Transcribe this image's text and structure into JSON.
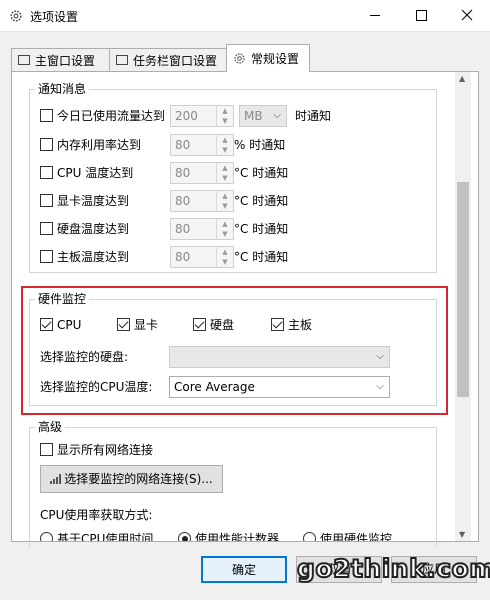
{
  "window": {
    "title": "选项设置"
  },
  "tabs": [
    {
      "label": "主窗口设置"
    },
    {
      "label": "任务栏窗口设置"
    },
    {
      "label": "常规设置"
    }
  ],
  "notify": {
    "title": "通知消息",
    "rows": [
      {
        "label": "今日已使用流量达到",
        "value": "200",
        "unit": "MB",
        "suffix": "时通知"
      },
      {
        "label": "内存利用率达到",
        "value": "80",
        "suffix": "% 时通知"
      },
      {
        "label": "CPU 温度达到",
        "value": "80",
        "suffix": "°C 时通知"
      },
      {
        "label": "显卡温度达到",
        "value": "80",
        "suffix": "°C 时通知"
      },
      {
        "label": "硬盘温度达到",
        "value": "80",
        "suffix": "°C 时通知"
      },
      {
        "label": "主板温度达到",
        "value": "80",
        "suffix": "°C 时通知"
      }
    ]
  },
  "hardware": {
    "title": "硬件监控",
    "checks": [
      {
        "label": "CPU"
      },
      {
        "label": "显卡"
      },
      {
        "label": "硬盘"
      },
      {
        "label": "主板"
      }
    ],
    "disk_label": "选择监控的硬盘:",
    "disk_value": "",
    "cpu_label": "选择监控的CPU温度:",
    "cpu_value": "Core Average"
  },
  "advanced": {
    "title": "高级",
    "show_all_label": "显示所有网络连接",
    "select_button": "选择要监控的网络连接(S)...",
    "cpu_method_label": "CPU使用率获取方式:",
    "radio1": "基于CPU使用时间",
    "radio2": "使用性能计数器",
    "radio3": "使用硬件监控"
  },
  "footer": {
    "ok": "确定",
    "cancel": "取消",
    "apply": "应用"
  },
  "watermark": "go2think.com",
  "colors": {
    "highlight_box": "#d9262c",
    "accent": "#0078d7"
  }
}
